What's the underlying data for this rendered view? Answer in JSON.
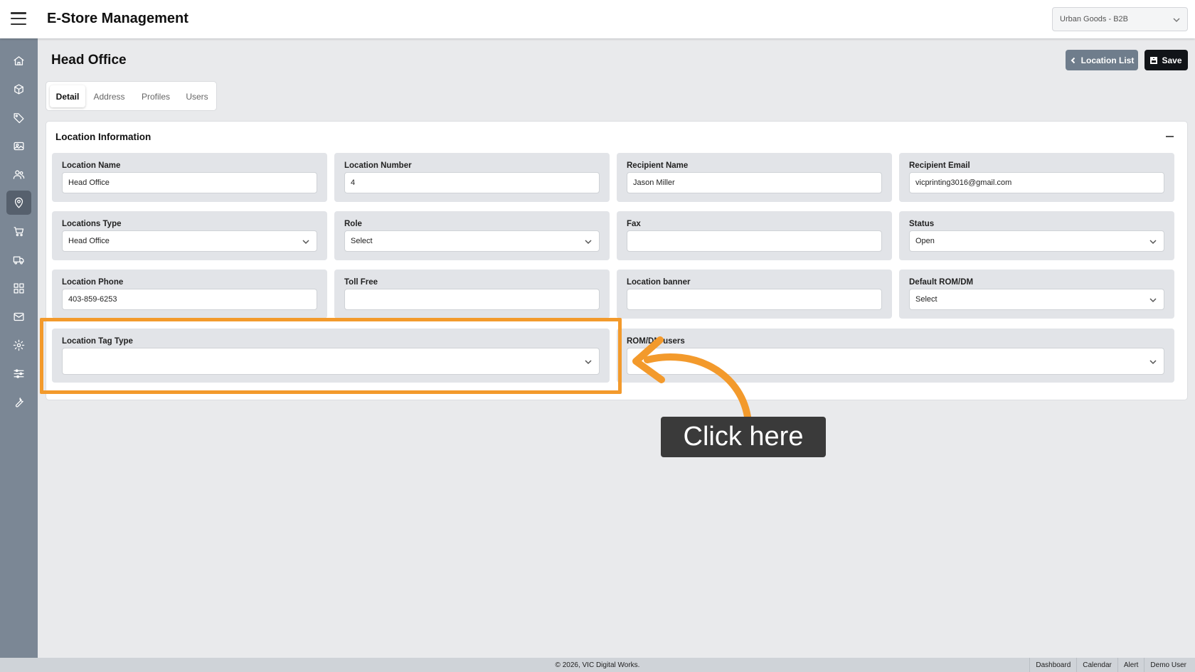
{
  "header": {
    "app_title": "E-Store Management",
    "store_selector_value": "Urban Goods - B2B"
  },
  "sidebar": {
    "items": [
      {
        "icon": "home-icon"
      },
      {
        "icon": "box-icon"
      },
      {
        "icon": "tag-icon"
      },
      {
        "icon": "image-icon"
      },
      {
        "icon": "users-icon"
      },
      {
        "icon": "location-pin-icon",
        "active": true
      },
      {
        "icon": "cart-icon"
      },
      {
        "icon": "truck-icon"
      },
      {
        "icon": "grid-icon"
      },
      {
        "icon": "mail-icon"
      },
      {
        "icon": "gear-icon"
      },
      {
        "icon": "sliders-icon"
      },
      {
        "icon": "wrench-icon"
      }
    ]
  },
  "page": {
    "title": "Head Office",
    "location_list_label": "Location List",
    "save_label": "Save"
  },
  "tabs": {
    "detail": "Detail",
    "address": "Address",
    "profiles": "Profiles",
    "users": "Users",
    "active": "Detail"
  },
  "card": {
    "title": "Location Information"
  },
  "fields": {
    "location_name": {
      "label": "Location Name",
      "value": "Head Office"
    },
    "location_number": {
      "label": "Location Number",
      "value": "4"
    },
    "recipient_name": {
      "label": "Recipient Name",
      "value": "Jason Miller"
    },
    "recipient_email": {
      "label": "Recipient Email",
      "value": "vicprinting3016@gmail.com"
    },
    "locations_type": {
      "label": "Locations Type",
      "value": "Head Office"
    },
    "role": {
      "label": "Role",
      "value": "Select"
    },
    "fax": {
      "label": "Fax",
      "value": ""
    },
    "status": {
      "label": "Status",
      "value": "Open"
    },
    "location_phone": {
      "label": "Location Phone",
      "value": "403-859-6253"
    },
    "toll_free": {
      "label": "Toll Free",
      "value": ""
    },
    "location_banner": {
      "label": "Location banner",
      "value": ""
    },
    "default_rom_dm": {
      "label": "Default ROM/DM",
      "value": "Select"
    },
    "location_tag_type": {
      "label": "Location Tag Type",
      "value": ""
    },
    "rom_dm_users": {
      "label": "ROM/DM users",
      "value": ""
    }
  },
  "tutorial": {
    "tooltip": "Click here",
    "accent_color": "#f39a2c"
  },
  "footer": {
    "copyright": "© 2026, VIC Digital Works.",
    "links": [
      "Dashboard",
      "Calendar",
      "Alert",
      "Demo User"
    ]
  }
}
